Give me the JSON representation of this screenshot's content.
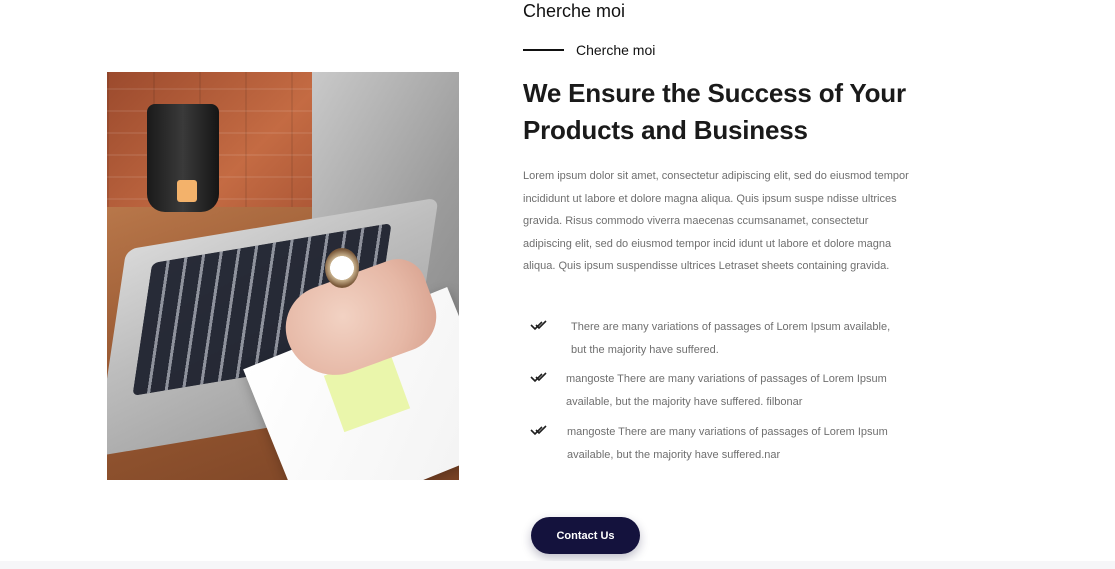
{
  "section": {
    "top_title": "Cherche moi",
    "subtitle": "Cherche moi",
    "heading": "We Ensure the Success of Your Products and Business",
    "paragraph": "Lorem ipsum dolor sit amet, consectetur adipiscing elit, sed do eiusmod tempor incididunt ut labore et dolore magna aliqua. Quis ipsum suspe ndisse ultrices gravida. Risus commodo viverra maecenas ccumsanamet, consectetur adipiscing elit, sed do eiusmod tempor incid idunt ut labore et dolore magna aliqua. Quis ipsum suspendisse ultrices Letraset sheets containing gravida.",
    "features": [
      {
        "icon": "double-check-icon",
        "text": "There are many variations of passages of Lorem Ipsum available, but the majority have suffered."
      },
      {
        "icon": "double-check-icon",
        "text": "mangoste There are many variations of passages of Lorem Ipsum available, but the majority have suffered. filbonar"
      },
      {
        "icon": "double-check-icon",
        "text": "mangoste There are many variations of passages of Lorem Ipsum available, but the majority have suffered.nar"
      }
    ],
    "button_label": "Contact Us",
    "image": {
      "subject": "laptop-work-photo"
    }
  },
  "colors": {
    "button_bg": "#14123d",
    "heading": "#1a1a1a",
    "body_text": "#6f6f6f",
    "accent_line": "#111111"
  }
}
